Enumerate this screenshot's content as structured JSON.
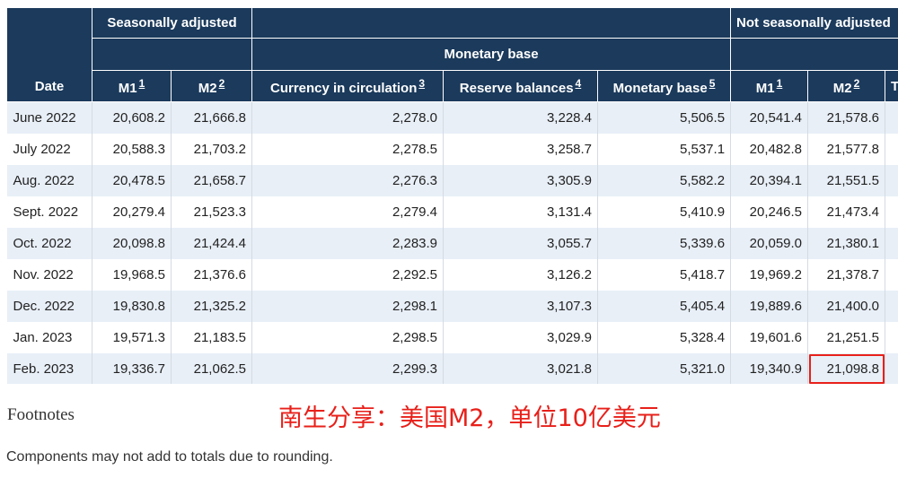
{
  "table": {
    "headers": {
      "date": "Date",
      "seasonally_adjusted": "Seasonally adjusted",
      "not_seasonally_adjusted": "Not seasonally adjusted",
      "monetary_base": "Monetary base",
      "m1": "M1",
      "m1_note": "1",
      "m2": "M2",
      "m2_note": "2",
      "currency": "Currency in circulation",
      "currency_note": "3",
      "reserve": "Reserve balances",
      "reserve_note": "4",
      "monetary_base_total": "Monetary base",
      "monetary_base_note": "5",
      "nsa_m1": "M1",
      "nsa_m1_note": "1",
      "nsa_m2": "M2",
      "nsa_m2_note": "2",
      "truncated": "T"
    },
    "rows": [
      {
        "date": "June 2022",
        "m1": "20,608.2",
        "m2": "21,666.8",
        "currency": "2,278.0",
        "reserve": "3,228.4",
        "base": "5,506.5",
        "nsa_m1": "20,541.4",
        "nsa_m2": "21,578.6"
      },
      {
        "date": "July 2022",
        "m1": "20,588.3",
        "m2": "21,703.2",
        "currency": "2,278.5",
        "reserve": "3,258.7",
        "base": "5,537.1",
        "nsa_m1": "20,482.8",
        "nsa_m2": "21,577.8"
      },
      {
        "date": "Aug. 2022",
        "m1": "20,478.5",
        "m2": "21,658.7",
        "currency": "2,276.3",
        "reserve": "3,305.9",
        "base": "5,582.2",
        "nsa_m1": "20,394.1",
        "nsa_m2": "21,551.5"
      },
      {
        "date": "Sept. 2022",
        "m1": "20,279.4",
        "m2": "21,523.3",
        "currency": "2,279.4",
        "reserve": "3,131.4",
        "base": "5,410.9",
        "nsa_m1": "20,246.5",
        "nsa_m2": "21,473.4"
      },
      {
        "date": "Oct. 2022",
        "m1": "20,098.8",
        "m2": "21,424.4",
        "currency": "2,283.9",
        "reserve": "3,055.7",
        "base": "5,339.6",
        "nsa_m1": "20,059.0",
        "nsa_m2": "21,380.1"
      },
      {
        "date": "Nov. 2022",
        "m1": "19,968.5",
        "m2": "21,376.6",
        "currency": "2,292.5",
        "reserve": "3,126.2",
        "base": "5,418.7",
        "nsa_m1": "19,969.2",
        "nsa_m2": "21,378.7"
      },
      {
        "date": "Dec. 2022",
        "m1": "19,830.8",
        "m2": "21,325.2",
        "currency": "2,298.1",
        "reserve": "3,107.3",
        "base": "5,405.4",
        "nsa_m1": "19,889.6",
        "nsa_m2": "21,400.0"
      },
      {
        "date": "Jan. 2023",
        "m1": "19,571.3",
        "m2": "21,183.5",
        "currency": "2,298.5",
        "reserve": "3,029.9",
        "base": "5,328.4",
        "nsa_m1": "19,601.6",
        "nsa_m2": "21,251.5"
      },
      {
        "date": "Feb. 2023",
        "m1": "19,336.7",
        "m2": "21,062.5",
        "currency": "2,299.3",
        "reserve": "3,021.8",
        "base": "5,321.0",
        "nsa_m1": "19,340.9",
        "nsa_m2": "21,098.8"
      }
    ]
  },
  "footnotes": {
    "title": "Footnotes",
    "text": "Components may not add to totals due to rounding."
  },
  "annotation": {
    "watermark": "南生分享：美国M2，单位10亿美元",
    "highlight_color": "#e8201a"
  },
  "colors": {
    "header_bg": "#1b3a5c",
    "row_alt": "#e8eff7"
  }
}
